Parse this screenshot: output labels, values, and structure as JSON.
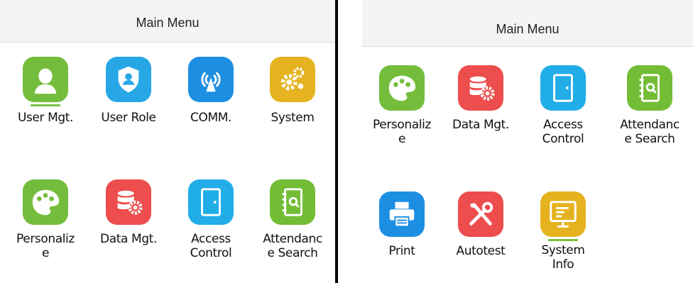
{
  "left_screen": {
    "title": "Main Menu",
    "items": [
      {
        "label": "User Mgt."
      },
      {
        "label": "User Role"
      },
      {
        "label": "COMM."
      },
      {
        "label": "System"
      },
      {
        "label": "Personaliz\ne"
      },
      {
        "label": "Data Mgt."
      },
      {
        "label": "Access\nControl"
      },
      {
        "label": "Attendanc\ne Search"
      }
    ]
  },
  "right_screen": {
    "title": "Main Menu",
    "items": [
      {
        "label": "Personaliz\ne"
      },
      {
        "label": "Data Mgt."
      },
      {
        "label": "Access\nControl"
      },
      {
        "label": "Attendanc\ne Search"
      },
      {
        "label": "Print"
      },
      {
        "label": "Autotest"
      },
      {
        "label": "System\nInfo"
      }
    ]
  },
  "colors": {
    "green": "#74bd3c",
    "blue": "#27a7e5",
    "yellow": "#e5b320",
    "red": "#ed4d4d",
    "cyan": "#21aee8"
  }
}
